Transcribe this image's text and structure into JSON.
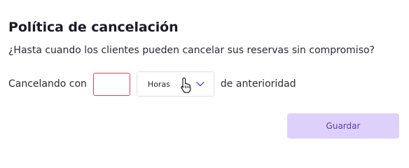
{
  "section": {
    "title": "Política de cancelación",
    "question": "¿Hasta cuando los clientes pueden cancelar sus reservas sin compromiso?"
  },
  "cancellation": {
    "prefix_label": "Cancelando con",
    "amount_value": "",
    "unit_selected": "Horas",
    "suffix_label": "de anterioridad"
  },
  "actions": {
    "save_label": "Guardar"
  },
  "icons": {
    "chevron": "chevron-down-icon",
    "cursor": "hand-pointer-cursor-icon"
  },
  "colors": {
    "input_error_border": "#d0465c",
    "button_background": "#ddd0fb",
    "button_text": "#5b3fa6",
    "chevron": "#6b4fd1"
  }
}
